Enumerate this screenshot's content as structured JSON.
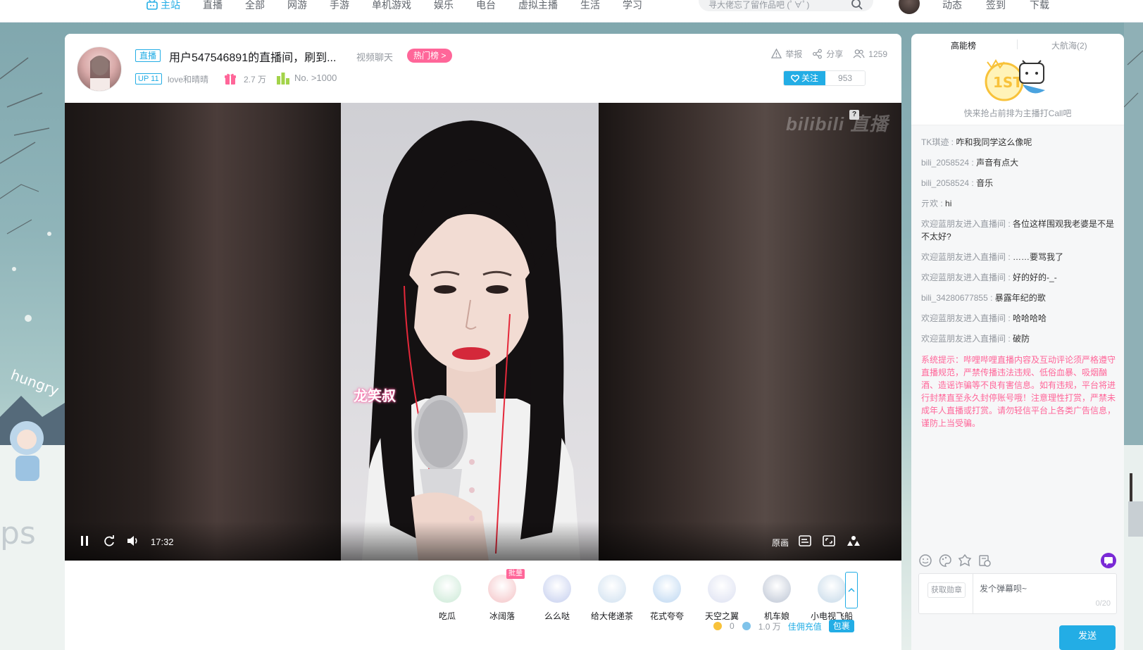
{
  "nav": {
    "items": [
      "主站",
      "直播",
      "全部",
      "网游",
      "手游",
      "单机游戏",
      "娱乐",
      "电台",
      "虚拟主播",
      "生活",
      "学习"
    ],
    "search_placeholder": "寻大佬忘了留作品吧 (ﾟ∀ﾟ)",
    "right_items": [
      "动态",
      "签到",
      "下载"
    ]
  },
  "room": {
    "live_tag": "直播",
    "title": "用户547546891的直播间，刷到...",
    "area": "视频聊天",
    "hot_rank": "热门榜 >",
    "up_tag": "UP 11",
    "up_name": "love和晴晴",
    "gift_count": "2.7 万",
    "rank_text": "No. >1000",
    "report": "举报",
    "share": "分享",
    "online": "1259",
    "follow_label": "关注",
    "follow_count": "953"
  },
  "player": {
    "watermark": "bilibili 直播",
    "help": "?",
    "time": "17:32",
    "quality": "原画",
    "overlay_text": "龙笑叔"
  },
  "gifts": [
    {
      "name": "吃瓜",
      "color": "#d9efe1",
      "badge": ""
    },
    {
      "name": "冰阔落",
      "color": "#f7d4d6",
      "badge": "批量"
    },
    {
      "name": "么么哒",
      "color": "#d5dcf3",
      "badge": ""
    },
    {
      "name": "给大佬递茶",
      "color": "#dde9f4",
      "badge": ""
    },
    {
      "name": "花式夸夸",
      "color": "#cfe2f5",
      "badge": ""
    },
    {
      "name": "天空之翼",
      "color": "#e6e9f5",
      "badge": ""
    },
    {
      "name": "机车娘",
      "color": "#cfd5e0",
      "badge": ""
    },
    {
      "name": "小电视飞船",
      "color": "#d6e4ef",
      "badge": ""
    }
  ],
  "wallet": {
    "coins_gold": "0",
    "coins_silver": "1.0 万",
    "recharge": "佳佣充值",
    "package": "包裹"
  },
  "side": {
    "tab_active": "高能榜",
    "tab_other": "大航海(2)",
    "rank_hint": "快来抢占前排为主播打Call吧",
    "chat": [
      {
        "user": "TK琪迹",
        "text": "咋和我同学这么像呢"
      },
      {
        "user": "bili_2058524",
        "text": "声音有点大"
      },
      {
        "user": "bili_2058524",
        "text": "音乐"
      },
      {
        "user": "亓欢",
        "text": "hi"
      },
      {
        "user": "欢迎蓝朋友进入直播间",
        "text": "各位这样围观我老婆是不是不太好?"
      },
      {
        "user": "欢迎蓝朋友进入直播间",
        "text": "……要骂我了"
      },
      {
        "user": "欢迎蓝朋友进入直播间",
        "text": "好的好的-_-"
      },
      {
        "user": "bili_34280677855",
        "text": "暴露年纪的歌"
      },
      {
        "user": "欢迎蓝朋友进入直播间",
        "text": "哈哈哈哈"
      },
      {
        "user": "欢迎蓝朋友进入直播间",
        "text": "破防"
      }
    ],
    "system": "系统提示：哔哩哔哩直播内容及互动评论须严格遵守直播规范，严禁传播违法违规、低俗血暴、吸烟酗酒、造谣诈骗等不良有害信息。如有违规，平台将进行封禁直至永久封停账号哦！注意理性打赏，严禁未成年人直播或打赏。请勿轻信平台上各类广告信息，谨防上当受骗。",
    "medal_btn": "获取勋章",
    "input_placeholder": "发个弹幕呗~",
    "input_count": "0/20",
    "send": "发送"
  }
}
